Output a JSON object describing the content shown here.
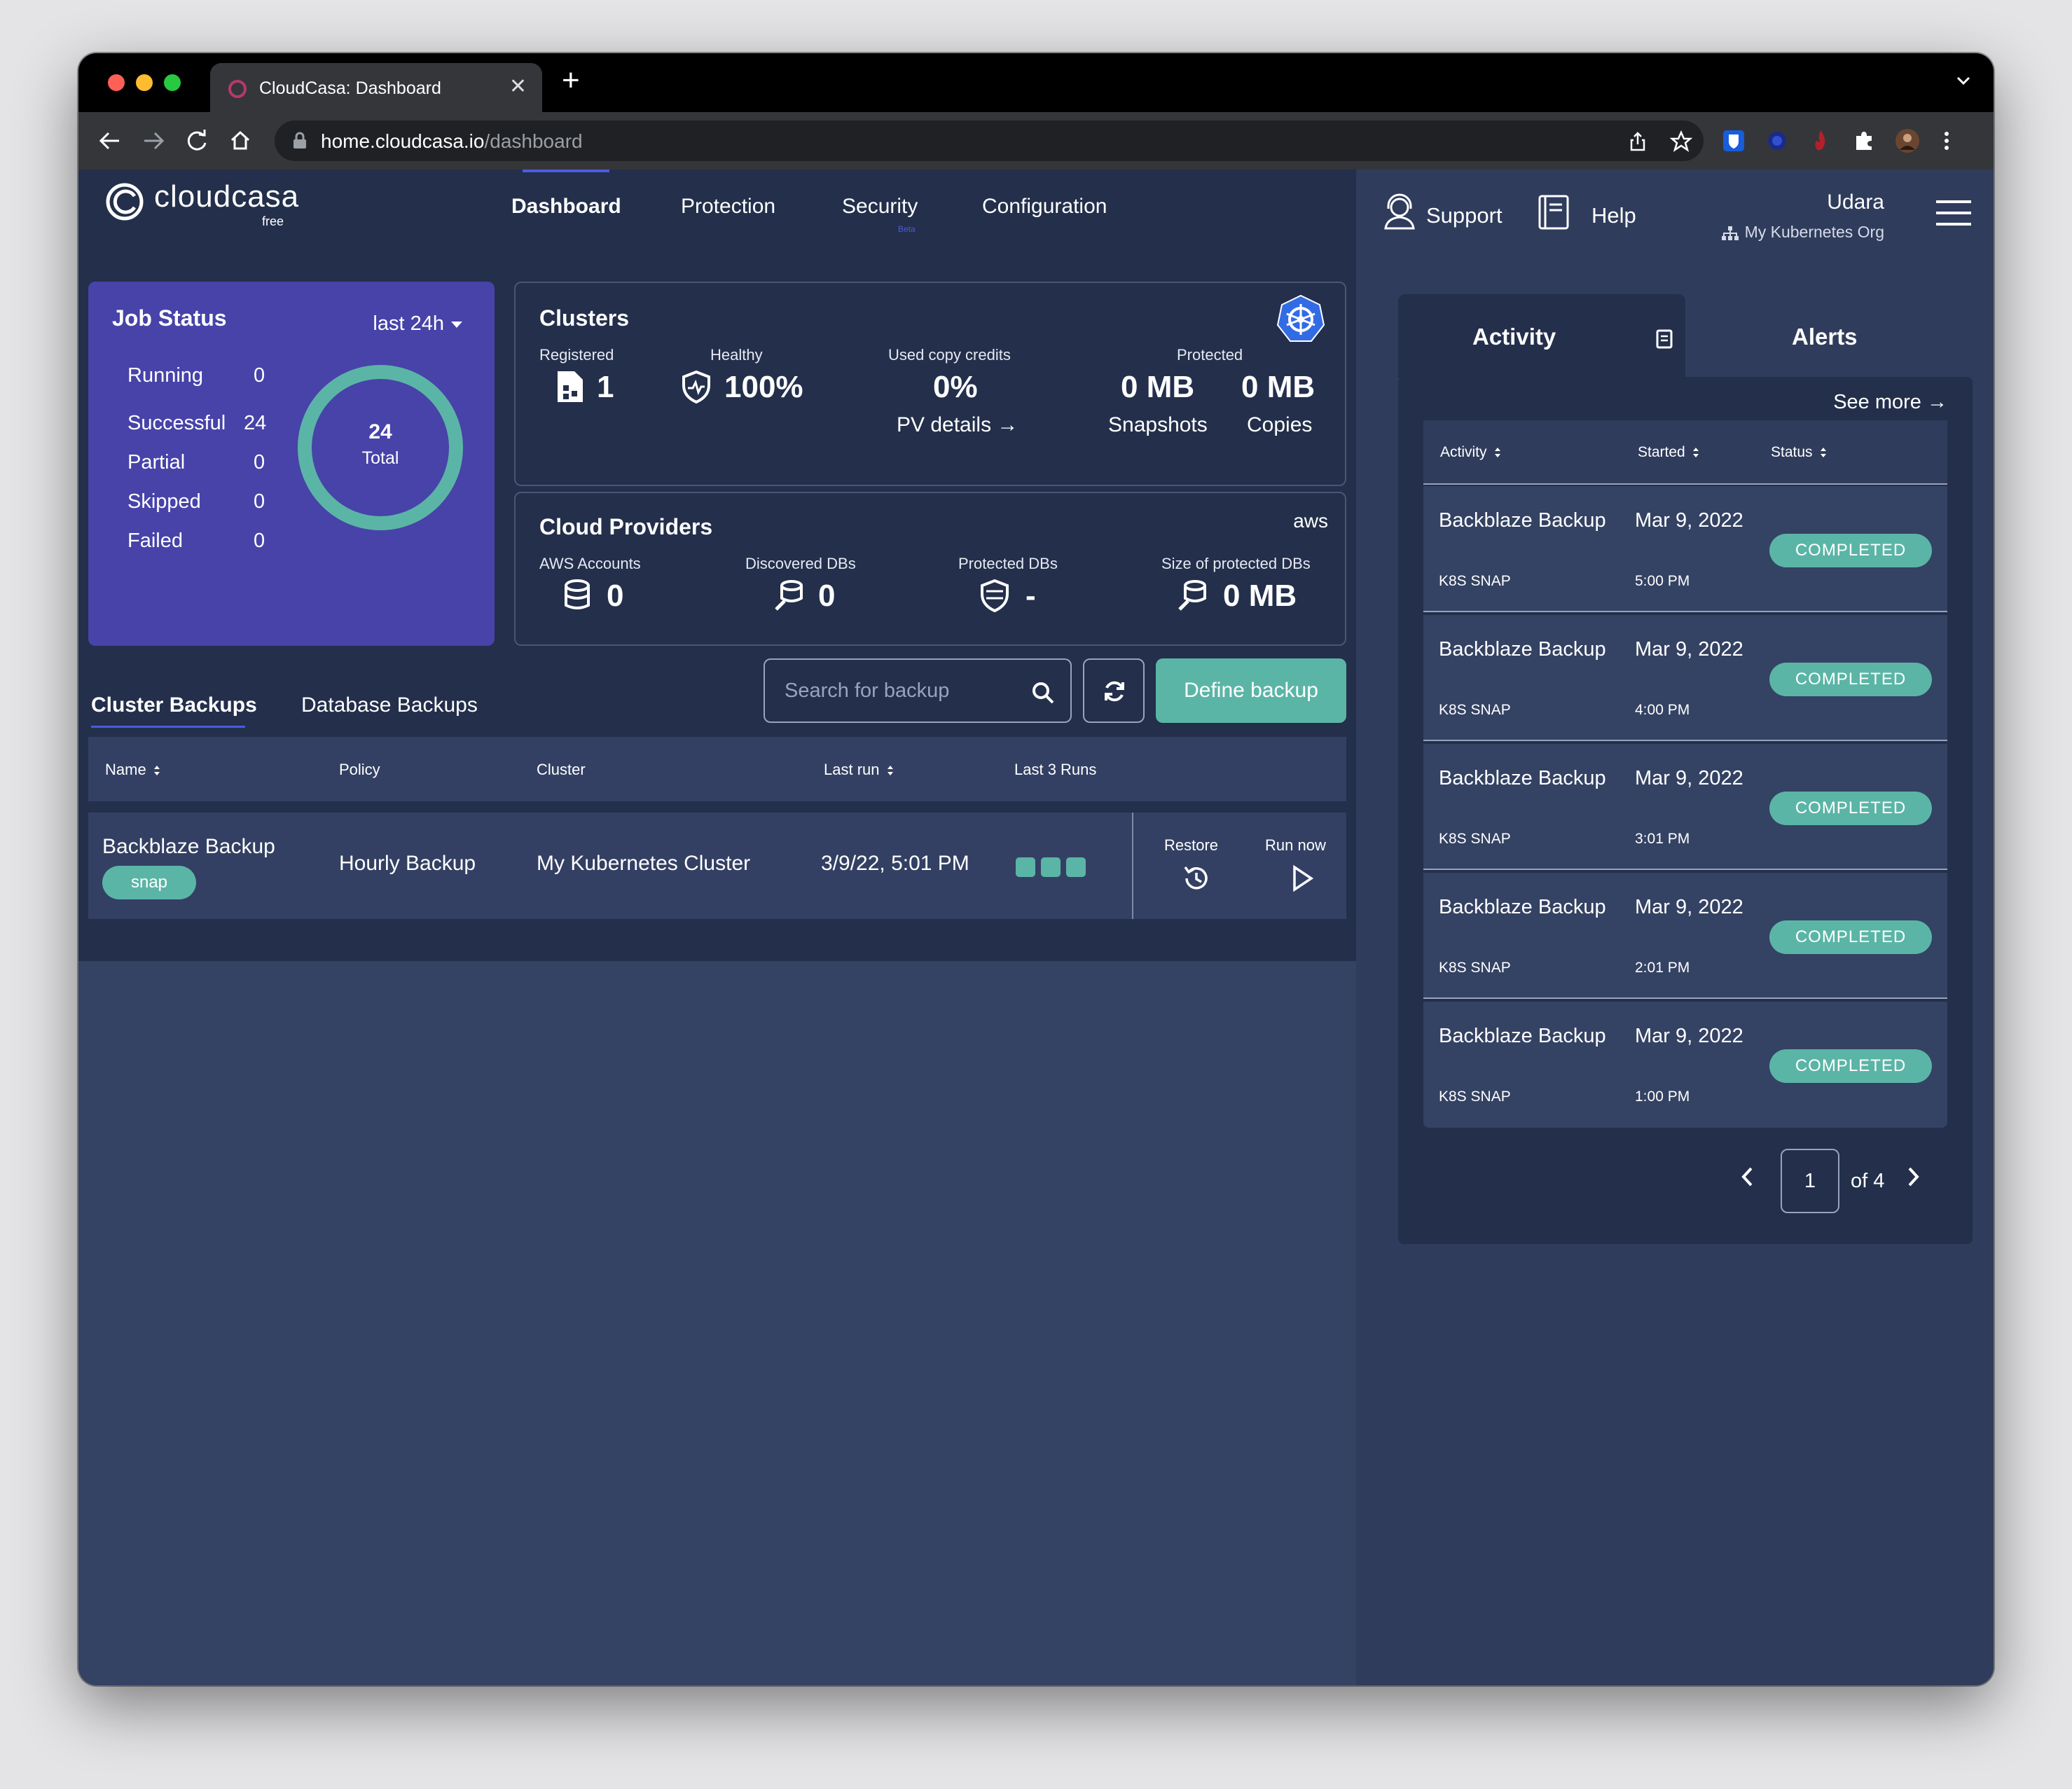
{
  "browser": {
    "tab_title": "CloudCasa: Dashboard",
    "url_host": "home.cloudcasa.io",
    "url_path": "/dashboard"
  },
  "brand": {
    "name": "cloudcasa",
    "tier": "free"
  },
  "nav": {
    "items": [
      "Dashboard",
      "Protection",
      "Security",
      "Configuration"
    ],
    "active": "Dashboard",
    "security_badge": "Beta"
  },
  "header": {
    "support": "Support",
    "help": "Help",
    "user_name": "Udara",
    "org_name": "My Kubernetes Org"
  },
  "job_status": {
    "title": "Job Status",
    "range": "last 24h",
    "rows": [
      {
        "label": "Running",
        "value": "0"
      },
      {
        "label": "Successful",
        "value": "24"
      },
      {
        "label": "Partial",
        "value": "0"
      },
      {
        "label": "Skipped",
        "value": "0"
      },
      {
        "label": "Failed",
        "value": "0"
      }
    ],
    "total_value": "24",
    "total_label": "Total",
    "ring_color": "#5bb5a6"
  },
  "clusters": {
    "title": "Clusters",
    "registered_label": "Registered",
    "registered_value": "1",
    "healthy_label": "Healthy",
    "healthy_value": "100%",
    "credits_label": "Used copy credits",
    "credits_value": "0%",
    "pv_link": "PV details →",
    "protected_label": "Protected",
    "snapshots_value": "0 MB",
    "snapshots_label": "Snapshots",
    "copies_value": "0 MB",
    "copies_label": "Copies"
  },
  "cloud_providers": {
    "title": "Cloud Providers",
    "provider_logo": "aws",
    "aws_accounts_label": "AWS Accounts",
    "aws_accounts_value": "0",
    "discovered_label": "Discovered DBs",
    "discovered_value": "0",
    "protected_label": "Protected DBs",
    "protected_value": "-",
    "size_label": "Size of protected DBs",
    "size_value": "0 MB"
  },
  "backups": {
    "tabs": [
      "Cluster Backups",
      "Database Backups"
    ],
    "active_tab": "Cluster Backups",
    "search_placeholder": "Search for backup",
    "define_button": "Define backup",
    "columns": [
      "Name",
      "Policy",
      "Cluster",
      "Last run",
      "Last 3 Runs"
    ],
    "rows": [
      {
        "name": "Backblaze Backup",
        "tag": "snap",
        "policy": "Hourly Backup",
        "cluster": "My Kubernetes Cluster",
        "last_run": "3/9/22, 5:01 PM",
        "restore_label": "Restore",
        "run_now_label": "Run now"
      }
    ],
    "accent_color": "#5bb5a6"
  },
  "activity": {
    "tab_activity": "Activity",
    "tab_alerts": "Alerts",
    "see_more": "See more →",
    "columns": [
      "Activity",
      "Started",
      "Status"
    ],
    "rows": [
      {
        "name": "Backblaze Backup",
        "type": "K8S SNAP",
        "date": "Mar 9, 2022",
        "time": "5:00 PM",
        "status": "COMPLETED"
      },
      {
        "name": "Backblaze Backup",
        "type": "K8S SNAP",
        "date": "Mar 9, 2022",
        "time": "4:00 PM",
        "status": "COMPLETED"
      },
      {
        "name": "Backblaze Backup",
        "type": "K8S SNAP",
        "date": "Mar 9, 2022",
        "time": "3:01 PM",
        "status": "COMPLETED"
      },
      {
        "name": "Backblaze Backup",
        "type": "K8S SNAP",
        "date": "Mar 9, 2022",
        "time": "2:01 PM",
        "status": "COMPLETED"
      },
      {
        "name": "Backblaze Backup",
        "type": "K8S SNAP",
        "date": "Mar 9, 2022",
        "time": "1:00 PM",
        "status": "COMPLETED"
      }
    ],
    "page": "1",
    "page_of": "of 4"
  }
}
